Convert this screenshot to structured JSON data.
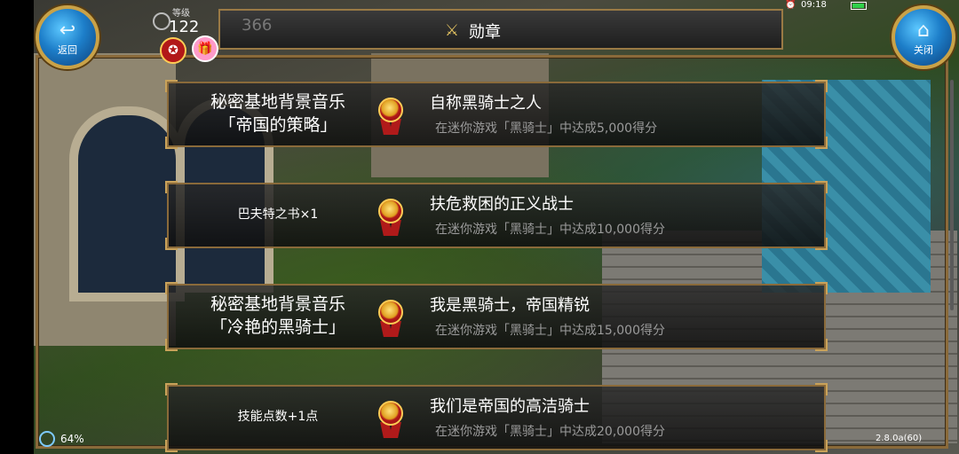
{
  "header": {
    "title": "勋章",
    "icon": "sword-medal-icon"
  },
  "nav": {
    "back_label": "返回",
    "back_icon": "back-arrow-icon",
    "close_label": "关闭",
    "close_icon": "home-icon"
  },
  "player": {
    "level_label": "等级",
    "level_value": "122",
    "ghost_number": "366"
  },
  "status": {
    "time": "09:18",
    "battery_fill": 0.9
  },
  "rows": [
    {
      "reward_line1": "秘密基地背景音乐",
      "reward_line2": "「帝国的策略」",
      "title": "自称黑骑士之人",
      "desc": "在迷你游戏「黑骑士」中达成5,000得分"
    },
    {
      "reward_line1": "巴夫特之书×1",
      "reward_line2": "",
      "title": "扶危救困的正义战士",
      "desc": "在迷你游戏「黑骑士」中达成10,000得分"
    },
    {
      "reward_line1": "秘密基地背景音乐",
      "reward_line2": "「冷艳的黑骑士」",
      "title": "我是黑骑士，帝国精锐",
      "desc": "在迷你游戏「黑骑士」中达成15,000得分"
    },
    {
      "reward_line1": "技能点数+1点",
      "reward_line2": "",
      "title": "我们是帝国的高洁骑士",
      "desc": "在迷你游戏「黑骑士」中达成20,000得分"
    }
  ],
  "footer": {
    "battery_pct": "64%",
    "version": "2.8.0a(60)"
  },
  "colors": {
    "frame": "#8a6a3a",
    "accent_gold": "#c9a25a",
    "desc_gray": "#9b9b9b",
    "button_blue": "#1d7ec9"
  }
}
